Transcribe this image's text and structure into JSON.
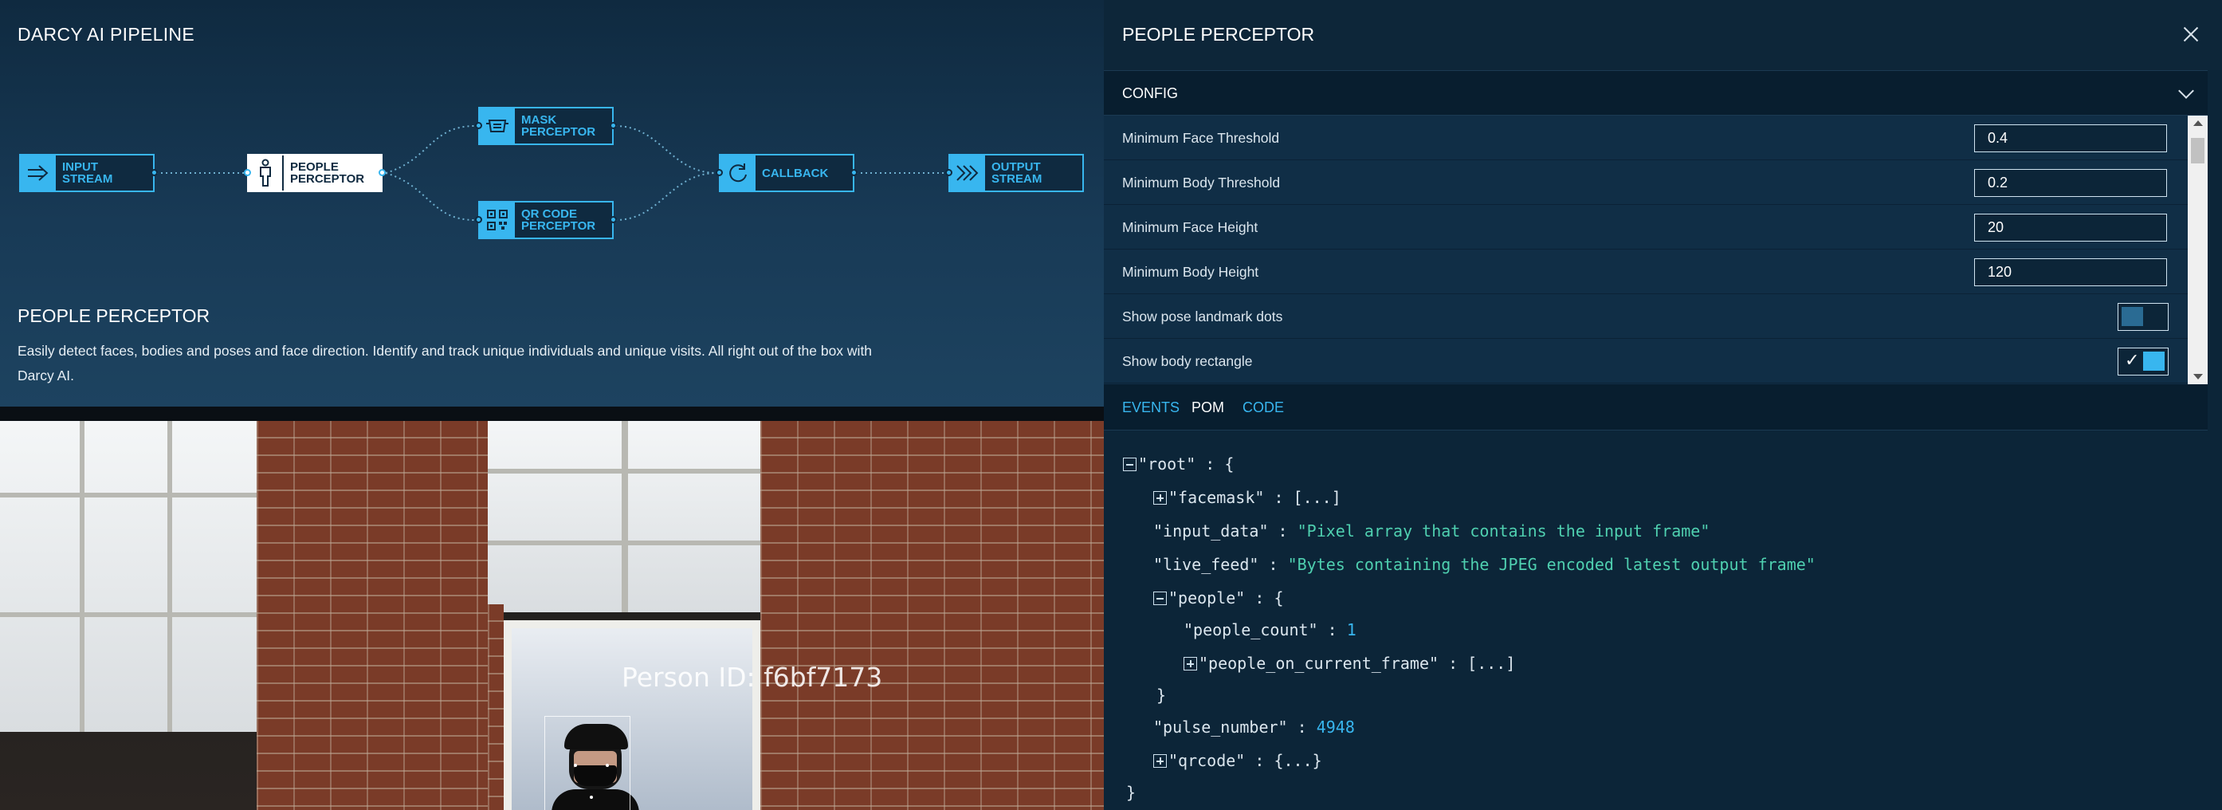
{
  "pipeline": {
    "title": "DARCY AI PIPELINE",
    "nodes": {
      "input": "INPUT\nSTREAM",
      "people": "PEOPLE\nPERCEPTOR",
      "mask": "MASK\nPERCEPTOR",
      "qr": "QR CODE\nPERCEPTOR",
      "callback": "CALLBACK",
      "output": "OUTPUT\nSTREAM"
    },
    "description_title": "PEOPLE PERCEPTOR",
    "description": "Easily detect faces, bodies and poses and face direction. Identify and track unique individuals and unique visits. All right out of the box with Darcy AI."
  },
  "camera": {
    "overlay_text": "Person ID: f6bf7173"
  },
  "panel": {
    "title": "PEOPLE PERCEPTOR",
    "config_label": "CONFIG",
    "rows": [
      {
        "label": "Minimum Face Threshold",
        "value": "0.4"
      },
      {
        "label": "Minimum Body Threshold",
        "value": "0.2"
      },
      {
        "label": "Minimum Face Height",
        "value": "20"
      },
      {
        "label": "Minimum Body Height",
        "value": "120"
      },
      {
        "label": "Show pose landmark dots",
        "toggle": "off"
      },
      {
        "label": "Show body rectangle",
        "toggle": "on"
      }
    ],
    "tabs": {
      "events": "EVENTS",
      "pom": "POM",
      "code": "CODE"
    }
  },
  "json_view": {
    "root_key": "\"root\"",
    "facemask_key": "\"facemask\"",
    "collapsed_array": "[...]",
    "collapsed_object": "{...}",
    "input_data_key": "\"input_data\"",
    "input_data_val": "\"Pixel array that contains the input frame\"",
    "live_feed_key": "\"live_feed\"",
    "live_feed_val": "\"Bytes containing the JPEG encoded latest output frame\"",
    "people_key": "\"people\"",
    "people_count_key": "\"people_count\"",
    "people_count_val": "1",
    "people_on_frame_key": "\"people_on_current_frame\"",
    "pulse_number_key": "\"pulse_number\"",
    "pulse_number_val": "4948",
    "qrcode_key": "\"qrcode\""
  },
  "colors": {
    "accent": "#38b6ef",
    "string": "#4fd0b0",
    "panel_bg": "#0c2538"
  },
  "icons": [
    "arrow-right-icon",
    "person-icon",
    "mask-icon",
    "qr-code-icon",
    "refresh-icon",
    "chevrons-right-icon",
    "close-icon",
    "chevron-down-icon",
    "checkmark-icon"
  ]
}
